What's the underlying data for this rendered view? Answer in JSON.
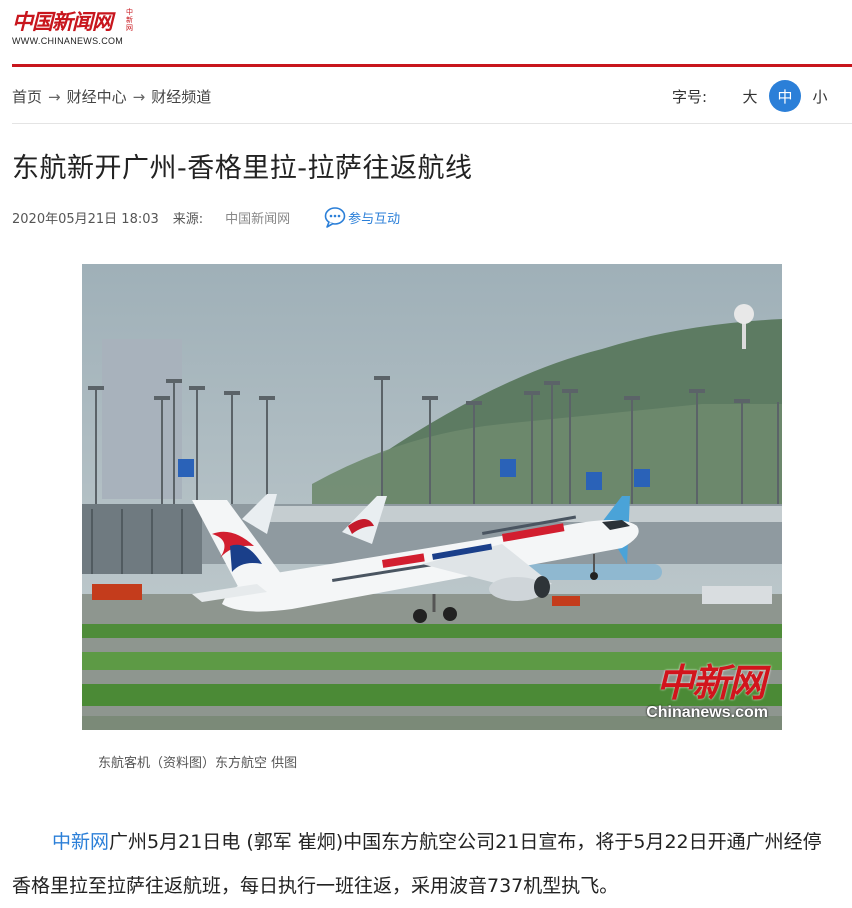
{
  "header": {
    "logo_cn": "中国新闻网",
    "logo_small": "中新网",
    "logo_en": "WWW.CHINANEWS.COM",
    "accent_color": "#c8161d"
  },
  "breadcrumb": {
    "items": [
      "首页",
      "财经中心",
      "财经频道"
    ],
    "separator": "→"
  },
  "font_size": {
    "label": "字号:",
    "options": [
      "大",
      "中",
      "小"
    ],
    "active": "中"
  },
  "article": {
    "title": "东航新开广州-香格里拉-拉萨往返航线",
    "date": "2020年05月21日 18:03",
    "source_label": "来源:",
    "source": "中国新闻网",
    "interact": "参与互动",
    "image_watermark_cn": "中新网",
    "image_watermark_en": "Chinanews.com",
    "caption": "东航客机（资料图）东方航空 供图",
    "body_source": "中新网",
    "body_rest": "广州5月21日电 (郭军 崔炯)中国东方航空公司21日宣布，将于5月22日开通广州经停香格里拉至拉萨往返航班，每日执行一班往返，采用波音737机型执飞。"
  }
}
